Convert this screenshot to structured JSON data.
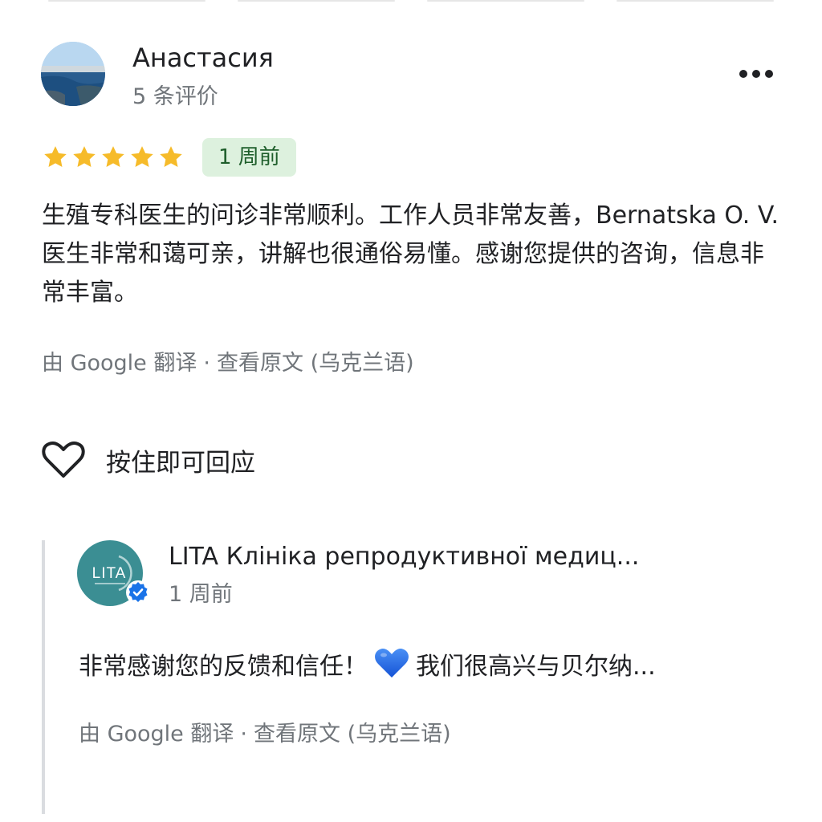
{
  "review": {
    "reviewer_name": "Анастасия",
    "reviewer_meta": "5 条评价",
    "rating": 5,
    "rating_max": 5,
    "time_ago": "1 周前",
    "text": "生殖专科医生的问诊非常顺利。工作人员非常友善，Bernatska O. V. 医生非常和蔼可亲，讲解也很通俗易懂。感谢您提供的咨询，信息非常丰富。",
    "translated_by": "由 Google 翻译",
    "separator": "·",
    "view_original": "查看原文 (乌克兰语)"
  },
  "like": {
    "label": "按住即可回应"
  },
  "owner_reply": {
    "owner_name": "LITA Клініка репродуктивної медиц...",
    "logo_text": "LITA",
    "time_ago": "1 周前",
    "text_before_emoji": "非常感谢您的反馈和信任！",
    "text_after_emoji": "我们很高兴与贝尔纳...",
    "translated_by": "由 Google 翻译",
    "separator": "·",
    "view_original": "查看原文 (乌克兰语)"
  },
  "icons": {
    "more": "more-horizontal-icon",
    "star": "star-icon",
    "like": "heart-outline-icon",
    "verified": "verified-check-icon",
    "emoji": "blue-heart-emoji"
  },
  "colors": {
    "star": "#f6bb2a",
    "badge_bg": "#ddf1de",
    "badge_text": "#1e5e2b",
    "secondary_text": "#70757a",
    "owner_logo": "#3b8e93",
    "verified": "#1a73e8",
    "emoji_heart": "#1a66e6"
  }
}
